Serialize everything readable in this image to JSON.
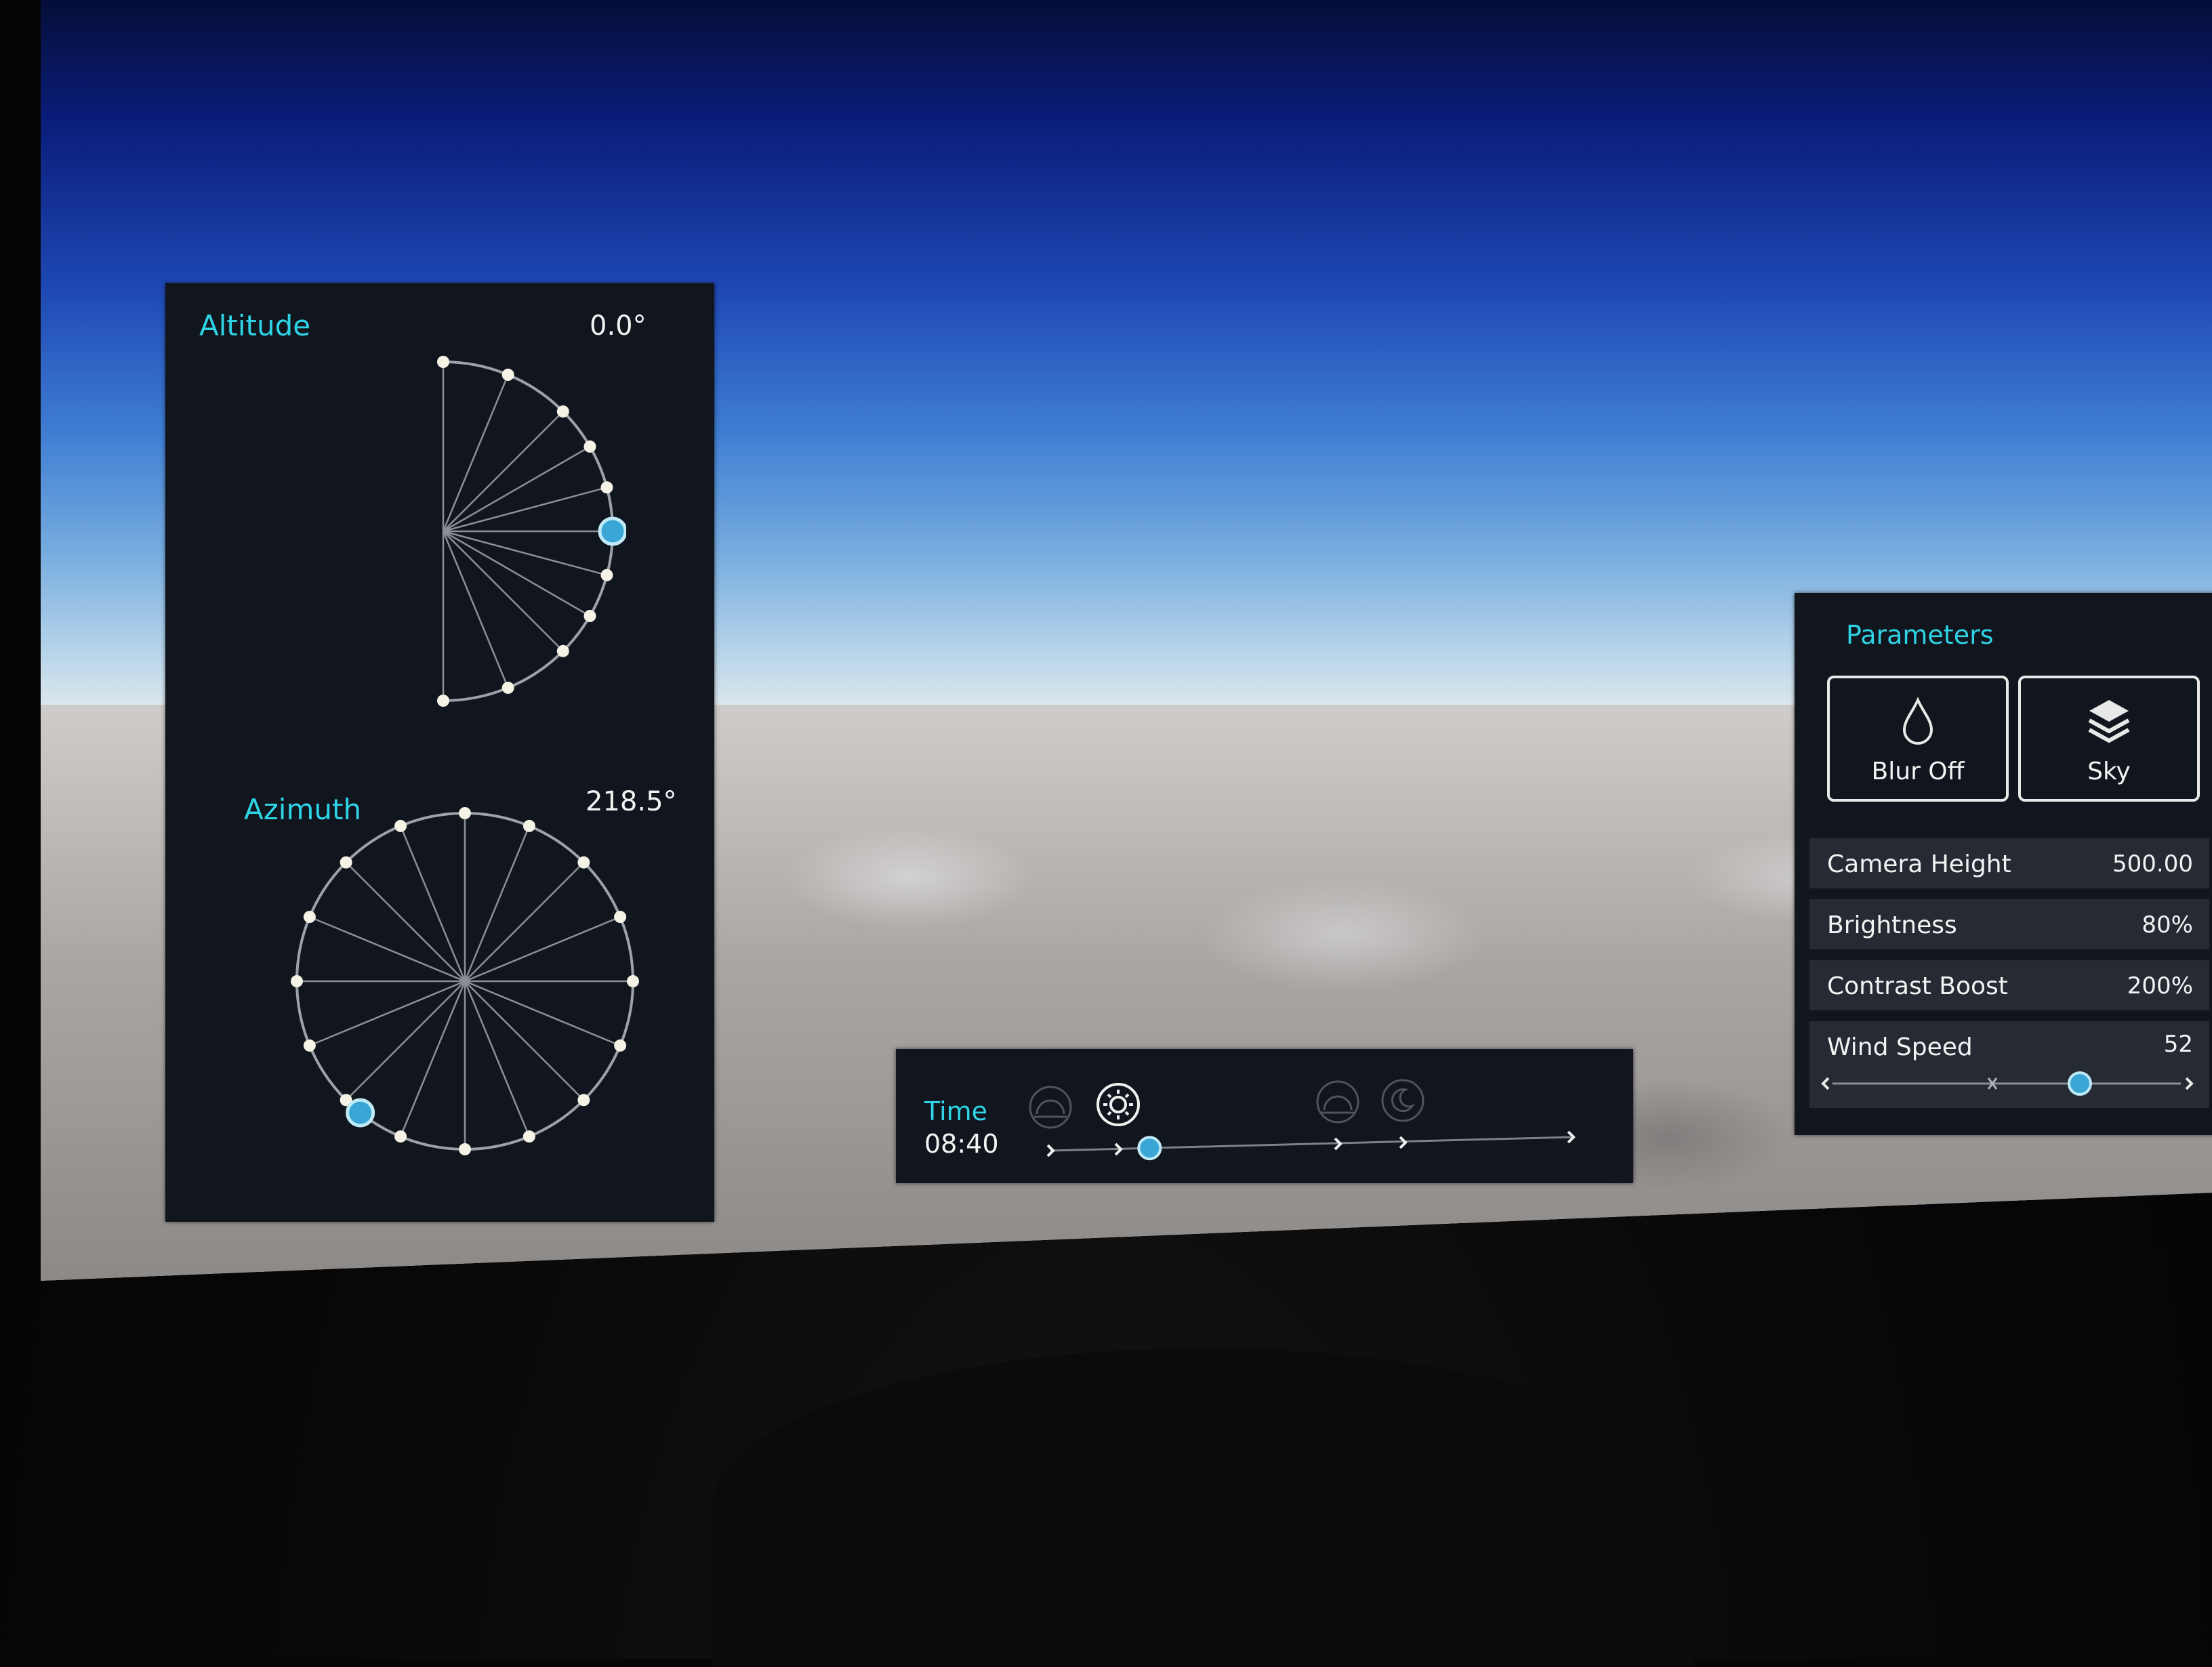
{
  "sun_position": {
    "altitude": {
      "label": "Altitude",
      "value": "0.0°",
      "degrees": 0.0
    },
    "azimuth": {
      "label": "Azimuth",
      "value": "218.5°",
      "degrees": 218.5
    }
  },
  "parameters": {
    "title": "Parameters",
    "buttons": [
      {
        "label": "Blur Off",
        "icon": "droplet-icon"
      },
      {
        "label": "Sky",
        "icon": "layers-icon"
      }
    ],
    "rows": [
      {
        "label": "Camera Height",
        "value": "500.00"
      },
      {
        "label": "Brightness",
        "value": "80%"
      },
      {
        "label": "Contrast Boost",
        "value": "200%"
      }
    ],
    "wind_speed": {
      "label": "Wind Speed",
      "value": "52",
      "fraction": 0.71
    }
  },
  "time": {
    "label": "Time",
    "value": "08:40",
    "presets": [
      "sunrise-icon",
      "sun-icon",
      "sunset-icon",
      "moon-icon"
    ],
    "active_preset": "sun-icon",
    "slider_fraction": 0.19
  },
  "colors": {
    "accent": "#2ed4e6",
    "handle": "#3aa6d6",
    "panel_bg": "#11151d",
    "row_bg": "#252a33"
  }
}
